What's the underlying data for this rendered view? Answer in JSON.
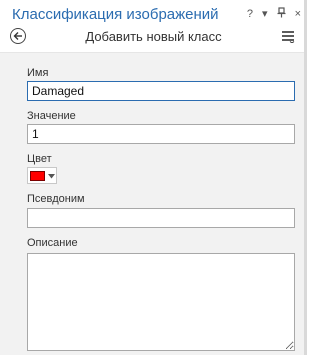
{
  "pane": {
    "title": "Классификация изображений",
    "controls": [
      "?",
      "▾",
      "⊥",
      "×"
    ]
  },
  "subheader": {
    "title": "Добавить новый класс",
    "back_icon": "back-arrow-circle-icon",
    "menu_icon": "hamburger-menu-icon"
  },
  "form": {
    "name_label": "Имя",
    "name_value": "Damaged",
    "value_label": "Значение",
    "value_value": "1",
    "color_label": "Цвет",
    "color_hex": "#ff0000",
    "alias_label": "Псевдоним",
    "alias_value": "",
    "description_label": "Описание",
    "description_value": ""
  }
}
